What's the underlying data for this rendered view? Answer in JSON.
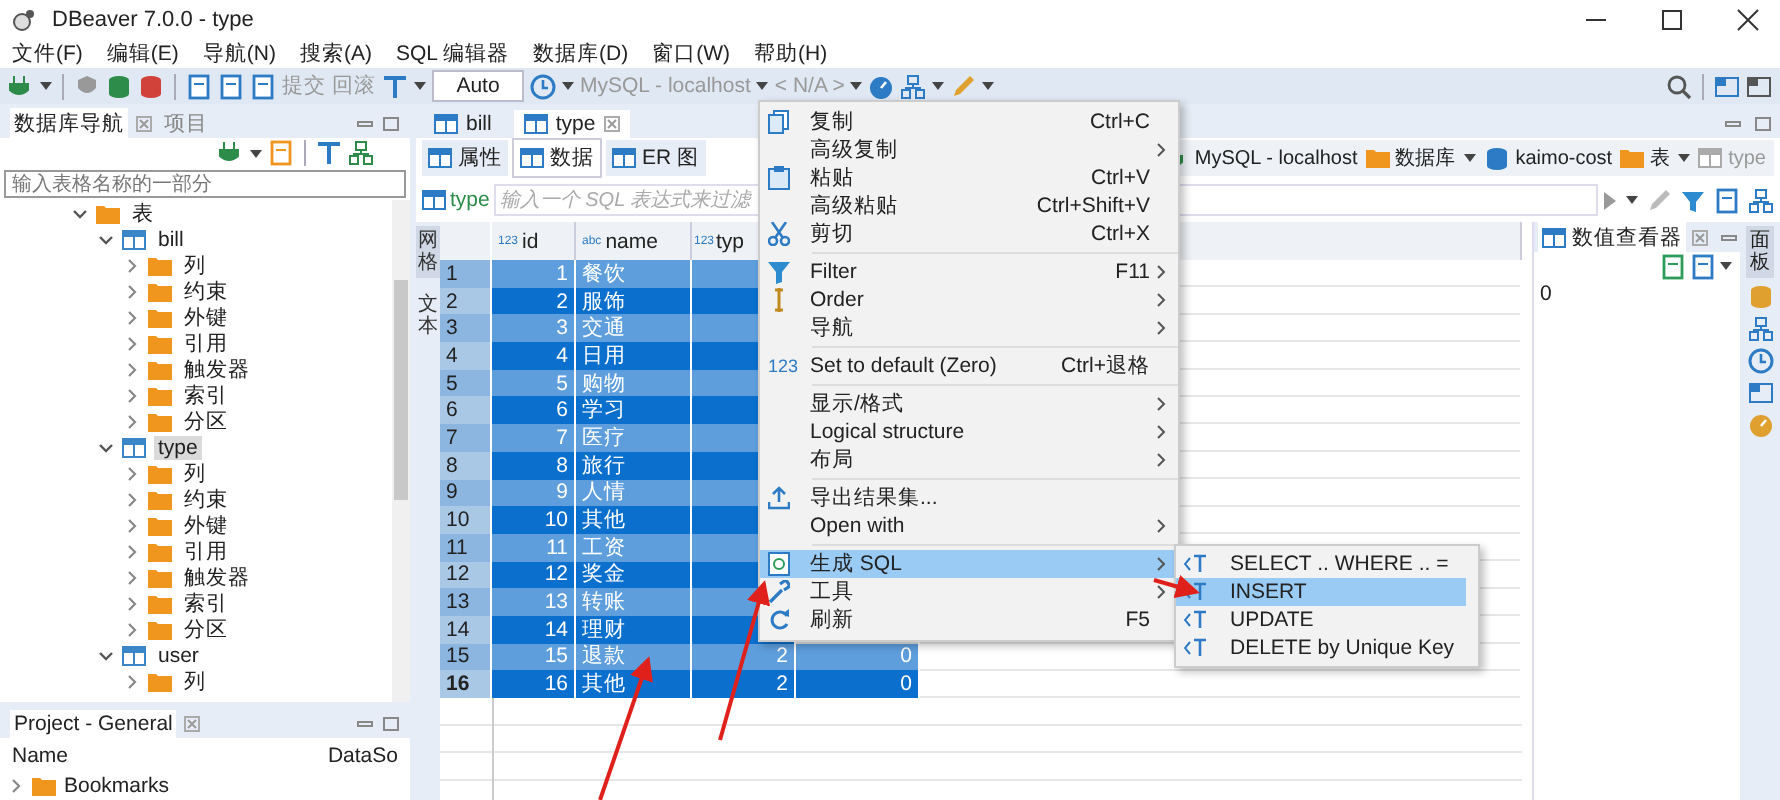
{
  "window": {
    "title": "DBeaver 7.0.0 - type"
  },
  "menu_bar": [
    "文件(F)",
    "编辑(E)",
    "导航(N)",
    "搜索(A)",
    "SQL 编辑器",
    "数据库(D)",
    "窗口(W)",
    "帮助(H)"
  ],
  "toolbar": {
    "commit": {
      "label": "提交",
      "disabled": true
    },
    "rollback": {
      "label": "回滚",
      "disabled": true
    },
    "mode": "Auto",
    "connection": {
      "label": "MySQL - localhost",
      "disabled": true
    },
    "schema": {
      "label": "< N/A >",
      "disabled": true
    }
  },
  "navigator": {
    "tabs": [
      {
        "label": "数据库导航",
        "selected": true
      },
      {
        "label": "项目",
        "selected": false
      }
    ],
    "filter": {
      "placeholder": "输入表格名称的一部分"
    },
    "tree": [
      {
        "label": "表",
        "kind": "tables",
        "expanded": true,
        "selected": false,
        "children": [
          {
            "label": "bill",
            "kind": "table",
            "expanded": true,
            "selected": false,
            "children": [
              {
                "label": "列",
                "kind": "folder",
                "expanded": false,
                "selected": false
              },
              {
                "label": "约束",
                "kind": "folder",
                "expanded": false,
                "selected": false
              },
              {
                "label": "外键",
                "kind": "folder",
                "expanded": false,
                "selected": false
              },
              {
                "label": "引用",
                "kind": "folder",
                "expanded": false,
                "selected": false
              },
              {
                "label": "触发器",
                "kind": "folder",
                "expanded": false,
                "selected": false
              },
              {
                "label": "索引",
                "kind": "folder",
                "expanded": false,
                "selected": false
              },
              {
                "label": "分区",
                "kind": "folder",
                "expanded": false,
                "selected": false
              }
            ]
          },
          {
            "label": "type",
            "kind": "table",
            "expanded": true,
            "selected": true,
            "children": [
              {
                "label": "列",
                "kind": "folder",
                "expanded": false,
                "selected": false
              },
              {
                "label": "约束",
                "kind": "folder",
                "expanded": false,
                "selected": false
              },
              {
                "label": "外键",
                "kind": "folder",
                "expanded": false,
                "selected": false
              },
              {
                "label": "引用",
                "kind": "folder",
                "expanded": false,
                "selected": false
              },
              {
                "label": "触发器",
                "kind": "folder",
                "expanded": false,
                "selected": false
              },
              {
                "label": "索引",
                "kind": "folder",
                "expanded": false,
                "selected": false
              },
              {
                "label": "分区",
                "kind": "folder",
                "expanded": false,
                "selected": false
              }
            ]
          },
          {
            "label": "user",
            "kind": "table",
            "expanded": true,
            "selected": false,
            "children": [
              {
                "label": "列",
                "kind": "folder",
                "expanded": false,
                "selected": false
              }
            ]
          }
        ]
      }
    ]
  },
  "project": {
    "title": "Project - General",
    "columns": [
      "Name",
      "DataSo"
    ],
    "rows": [
      {
        "name": "Bookmarks",
        "expanded": false
      }
    ]
  },
  "editor_tabs": [
    {
      "label": "bill",
      "selected": false
    },
    {
      "label": "type",
      "selected": true
    }
  ],
  "sub_tabs": [
    {
      "label": "属性",
      "selected": false
    },
    {
      "label": "数据",
      "selected": true
    },
    {
      "label": "ER 图",
      "selected": false
    }
  ],
  "breadcrumbs": [
    {
      "label": "MySQL - localhost",
      "kind": "connection",
      "disabled": false
    },
    {
      "label": "数据库",
      "kind": "folder",
      "disabled": false
    },
    {
      "label": "kaimo-cost",
      "kind": "database",
      "disabled": false
    },
    {
      "label": "表",
      "kind": "tables",
      "disabled": false
    },
    {
      "label": "type",
      "kind": "table",
      "disabled": true
    }
  ],
  "filter_bar": {
    "table": "type",
    "placeholder": "输入一个 SQL 表达式来过滤"
  },
  "view_tabs": [
    {
      "label": "网格",
      "selected": true
    },
    {
      "label": "文本",
      "selected": false
    }
  ],
  "grid": {
    "columns": [
      {
        "type": "123",
        "label": "id"
      },
      {
        "type": "abc",
        "label": "name"
      },
      {
        "type": "123",
        "label": "typ"
      }
    ],
    "rows": [
      {
        "num": "1",
        "id": "1",
        "name": "餐饮",
        "selected": true,
        "current": false
      },
      {
        "num": "2",
        "id": "2",
        "name": "服饰",
        "selected": true,
        "current": false
      },
      {
        "num": "3",
        "id": "3",
        "name": "交通",
        "selected": true,
        "current": false
      },
      {
        "num": "4",
        "id": "4",
        "name": "日用",
        "selected": true,
        "current": false
      },
      {
        "num": "5",
        "id": "5",
        "name": "购物",
        "selected": true,
        "current": false
      },
      {
        "num": "6",
        "id": "6",
        "name": "学习",
        "selected": true,
        "current": false
      },
      {
        "num": "7",
        "id": "7",
        "name": "医疗",
        "selected": true,
        "current": false
      },
      {
        "num": "8",
        "id": "8",
        "name": "旅行",
        "selected": true,
        "current": false
      },
      {
        "num": "9",
        "id": "9",
        "name": "人情",
        "selected": true,
        "current": false
      },
      {
        "num": "10",
        "id": "10",
        "name": "其他",
        "selected": true,
        "current": false
      },
      {
        "num": "11",
        "id": "11",
        "name": "工资",
        "selected": true,
        "current": false
      },
      {
        "num": "12",
        "id": "12",
        "name": "奖金",
        "selected": true,
        "current": false
      },
      {
        "num": "13",
        "id": "13",
        "name": "转账",
        "selected": true,
        "current": false
      },
      {
        "num": "14",
        "id": "14",
        "name": "理财",
        "selected": true,
        "current": false
      },
      {
        "num": "15",
        "id": "15",
        "name": "退款",
        "type": "2",
        "column_4": "0",
        "selected": true,
        "current": false
      },
      {
        "num": "16",
        "id": "16",
        "name": "其他",
        "type": "2",
        "column_4": "0",
        "selected": true,
        "current": true
      }
    ]
  },
  "value_viewer": {
    "title": "数值查看器",
    "value": "0"
  },
  "side_panel_tab": {
    "label": "面板",
    "selected": true
  },
  "context_menu": [
    {
      "kind": "item",
      "label": "复制",
      "shortcut": "Ctrl+C",
      "submenu": false,
      "highlighted": false
    },
    {
      "kind": "item",
      "label": "高级复制",
      "submenu": true,
      "highlighted": false
    },
    {
      "kind": "item",
      "label": "粘贴",
      "shortcut": "Ctrl+V",
      "submenu": false,
      "highlighted": false
    },
    {
      "kind": "item",
      "label": "高级粘贴",
      "shortcut": "Ctrl+Shift+V",
      "submenu": false,
      "highlighted": false
    },
    {
      "kind": "item",
      "label": "剪切",
      "shortcut": "Ctrl+X",
      "submenu": false,
      "highlighted": false
    },
    {
      "kind": "separator"
    },
    {
      "kind": "item",
      "label": "Filter",
      "shortcut": "F11",
      "submenu": true,
      "highlighted": false
    },
    {
      "kind": "item",
      "label": "Order",
      "submenu": true,
      "highlighted": false
    },
    {
      "kind": "item",
      "label": "导航",
      "submenu": true,
      "highlighted": false
    },
    {
      "kind": "separator"
    },
    {
      "kind": "item",
      "badge": "123",
      "label": "Set to default (Zero)",
      "shortcut": "Ctrl+退格",
      "submenu": false,
      "highlighted": false
    },
    {
      "kind": "separator"
    },
    {
      "kind": "item",
      "label": "显示/格式",
      "submenu": true,
      "highlighted": false
    },
    {
      "kind": "item",
      "label": "Logical structure",
      "submenu": true,
      "highlighted": false
    },
    {
      "kind": "item",
      "label": "布局",
      "submenu": true,
      "highlighted": false
    },
    {
      "kind": "separator"
    },
    {
      "kind": "item",
      "label": "导出结果集...",
      "submenu": false,
      "highlighted": false
    },
    {
      "kind": "item",
      "label": "Open with",
      "submenu": true,
      "highlighted": false
    },
    {
      "kind": "separator"
    },
    {
      "kind": "item",
      "label": "生成 SQL",
      "submenu": true,
      "highlighted": true
    },
    {
      "kind": "item",
      "label": "工具",
      "submenu": true,
      "highlighted": false
    },
    {
      "kind": "item",
      "label": "刷新",
      "shortcut": "F5",
      "submenu": false,
      "highlighted": false
    }
  ],
  "submenu": [
    {
      "label": "SELECT .. WHERE .. =",
      "selected": false
    },
    {
      "label": "INSERT",
      "selected": true
    },
    {
      "label": "UPDATE",
      "selected": false
    },
    {
      "label": "DELETE by Unique Key",
      "selected": false
    }
  ]
}
